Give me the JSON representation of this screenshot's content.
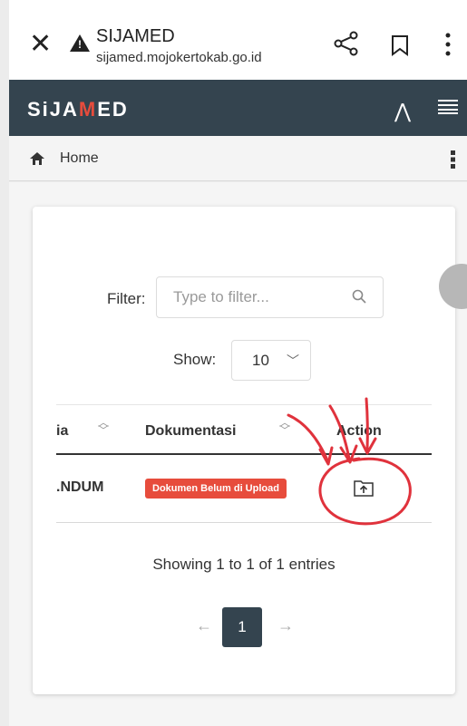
{
  "browser": {
    "title": "SIJAMED",
    "url": "sijamed.mojokertokab.go.id"
  },
  "app": {
    "brand_prefix": "SiJA",
    "brand_m": "M",
    "brand_suffix": "ED"
  },
  "breadcrumb": {
    "home": "Home"
  },
  "filter": {
    "label": "Filter:",
    "placeholder": "Type to filter..."
  },
  "show": {
    "label": "Show:",
    "value": "10"
  },
  "table": {
    "headers": [
      "ia",
      "Dokumentasi",
      "Action"
    ],
    "rows": [
      {
        "first": ".NDUM",
        "status": "Dokumen Belum di Upload"
      }
    ]
  },
  "info": "Showing 1 to 1 of 1 entries",
  "pagination": {
    "prev": "←",
    "current": "1",
    "next": "→"
  },
  "colors": {
    "navbar": "#34444f",
    "badge": "#e74c3c",
    "annotation": "#e0323c"
  }
}
